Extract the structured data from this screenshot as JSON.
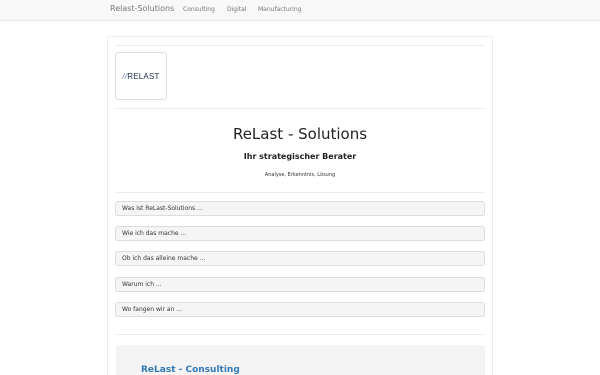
{
  "navbar": {
    "brand": "Relast-Solutions",
    "links": [
      "Consulting",
      "Digital",
      "Manufacturing"
    ]
  },
  "logo": {
    "slashes": "//",
    "text": "RELAST"
  },
  "hero": {
    "title": "ReLast - Solutions",
    "subtitle": "Ihr strategischer Berater",
    "tagline": "Analyse, Erkenntnis, Lösung"
  },
  "accordion": [
    "Was ist ReLast-Solutions ...",
    "Wie ich das mache ...",
    "Ob ich das alleine mache ...",
    "Warum ich ...",
    "Wo fangen wir an ..."
  ],
  "section": {
    "title": "ReLast - Consulting"
  }
}
